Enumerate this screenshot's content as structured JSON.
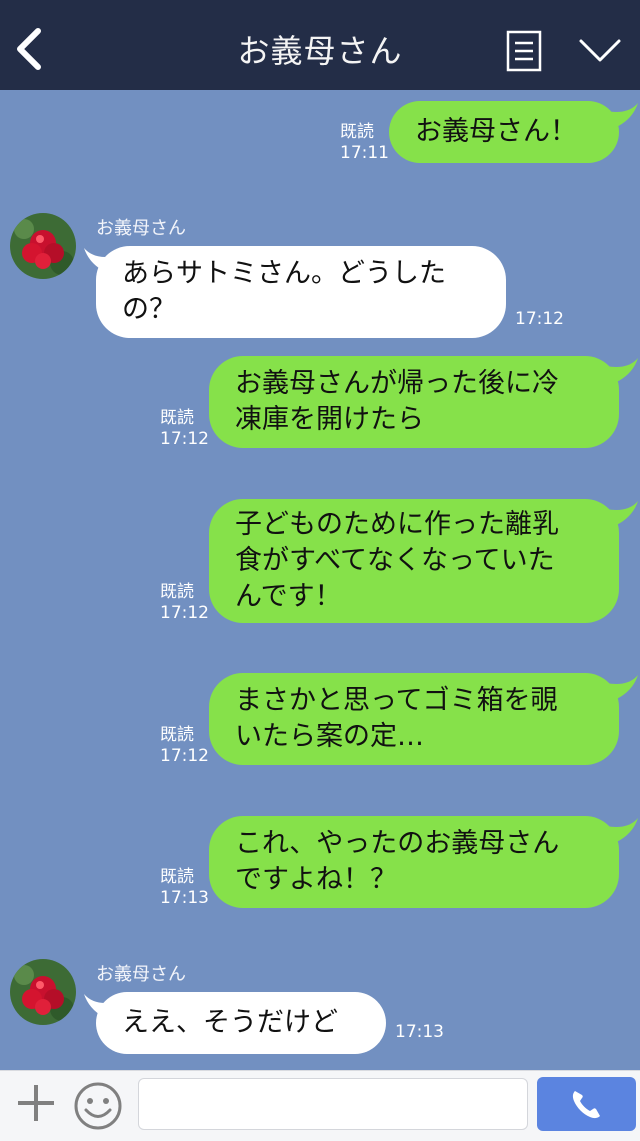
{
  "header": {
    "title": "お義母さん"
  },
  "messages": [
    {
      "lines": [
        "お義母さん！"
      ],
      "read": "既読",
      "time": "17:11"
    },
    {
      "sender": "お義母さん",
      "lines": [
        "あらサトミさん。どうした",
        "の？"
      ],
      "time": "17:12"
    },
    {
      "lines": [
        "お義母さんが帰った後に冷",
        "凍庫を開けたら"
      ],
      "read": "既読",
      "time": "17:12"
    },
    {
      "lines": [
        "子どものために作った離乳",
        "食がすべてなくなっていた",
        "んです！"
      ],
      "read": "既読",
      "time": "17:12"
    },
    {
      "lines": [
        "まさかと思ってゴミ箱を覗",
        "いたら案の定…"
      ],
      "read": "既読",
      "time": "17:12"
    },
    {
      "lines": [
        "これ、やったのお義母さん",
        "ですよね！？"
      ],
      "read": "既読",
      "time": "17:13"
    },
    {
      "sender": "お義母さん",
      "lines": [
        "ええ、そうだけど"
      ],
      "time": "17:13"
    }
  ],
  "footer": {
    "input_value": ""
  },
  "colors": {
    "background": "#7290c1",
    "header": "#232d47",
    "my_bubble": "#86e14a",
    "other_bubble": "#ffffff",
    "call_button": "#5b84e0"
  },
  "icons": [
    "back-icon",
    "menu-icon",
    "chevron-down-icon",
    "plus-icon",
    "smiley-icon",
    "phone-icon"
  ]
}
